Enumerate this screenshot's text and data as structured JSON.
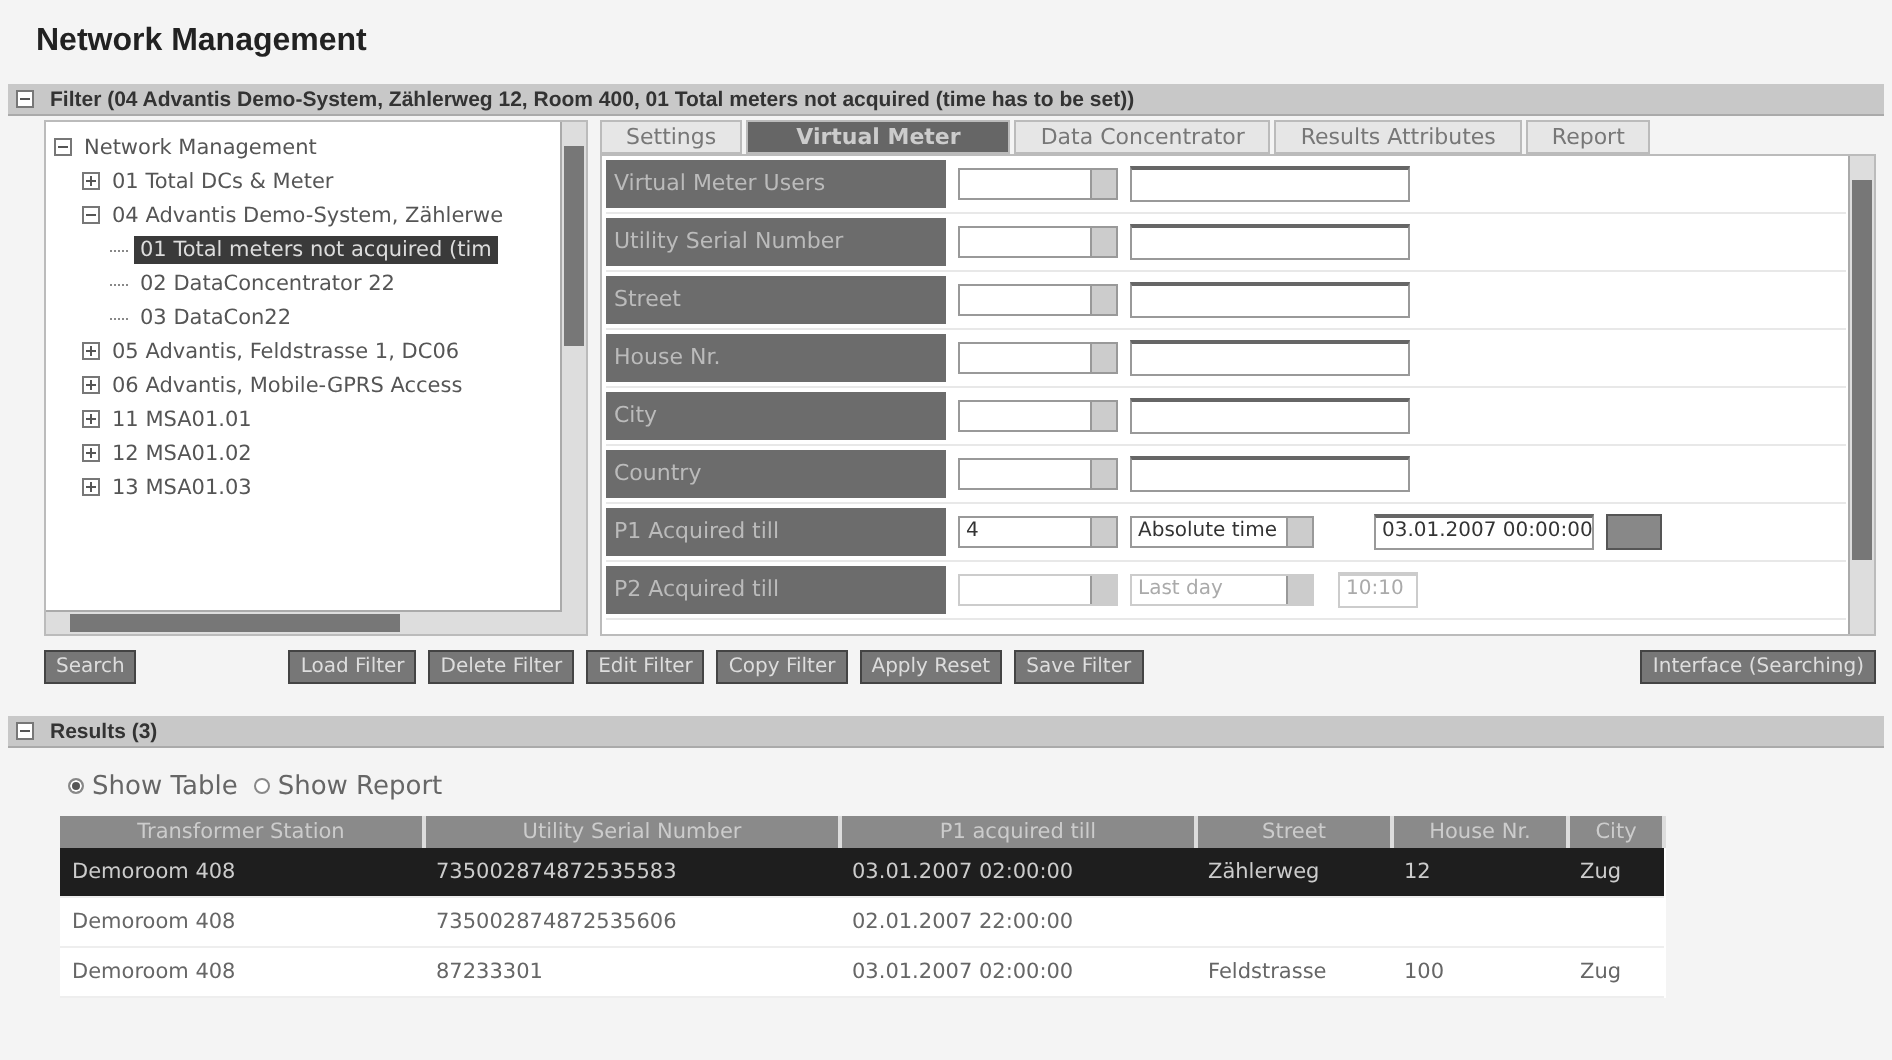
{
  "title": "Network Management",
  "filter": {
    "header": "Filter (04 Advantis Demo-System, Zählerweg 12, Room 400, 01 Total meters not acquired (time has to be set))",
    "expanded": true,
    "tree": [
      {
        "label": "Network Management",
        "expanded": true,
        "selected": false,
        "children": [
          {
            "label": "01 Total DCs & Meter",
            "expanded": false,
            "selected": false
          },
          {
            "label": "04 Advantis Demo-System, Zählerwe",
            "expanded": true,
            "selected": false,
            "children": [
              {
                "label": "01 Total meters not acquired (tim",
                "selected": true
              },
              {
                "label": "02 DataConcentrator 22",
                "selected": false
              },
              {
                "label": "03 DataCon22",
                "selected": false
              }
            ]
          },
          {
            "label": "05 Advantis, Feldstrasse 1, DC06",
            "expanded": false,
            "selected": false
          },
          {
            "label": "06 Advantis, Mobile-GPRS Access",
            "expanded": false,
            "selected": false
          },
          {
            "label": "11 MSA01.01",
            "expanded": false,
            "selected": false
          },
          {
            "label": "12 MSA01.02",
            "expanded": false,
            "selected": false
          },
          {
            "label": "13 MSA01.03",
            "expanded": false,
            "selected": false
          }
        ]
      }
    ],
    "tabs": [
      {
        "label": "Settings",
        "selected": false
      },
      {
        "label": "Virtual Meter",
        "selected": true
      },
      {
        "label": "Data Concentrator",
        "selected": false
      },
      {
        "label": "Results Attributes",
        "selected": false
      },
      {
        "label": "Report",
        "selected": false
      }
    ],
    "rows": [
      {
        "kind": "text",
        "label": "Virtual Meter Users",
        "operator": "",
        "disabled": false
      },
      {
        "kind": "text",
        "label": "Utility Serial Number",
        "operator": "",
        "disabled": false
      },
      {
        "kind": "text",
        "label": "Street",
        "operator": "",
        "disabled": false
      },
      {
        "kind": "text",
        "label": "House Nr.",
        "operator": "",
        "disabled": false
      },
      {
        "kind": "text",
        "label": "City",
        "operator": "",
        "disabled": false
      },
      {
        "kind": "text",
        "label": "Country",
        "operator": "",
        "disabled": false
      },
      {
        "kind": "time",
        "label": "P1 Acquired till",
        "operator": "4",
        "mode": "Absolute time",
        "time": "03.01.2007 00:00:00",
        "disabled": false
      },
      {
        "kind": "time",
        "label": "P2 Acquired till",
        "operator": "",
        "mode": "Last day",
        "time": "10:10",
        "disabled": true
      }
    ],
    "search_buttons": [
      "Search"
    ],
    "filter_buttons": [
      "Load Filter",
      "Delete Filter",
      "Edit Filter",
      "Copy Filter",
      "Apply Reset",
      "Save Filter"
    ],
    "side_buttons": [
      "Interface (Searching)"
    ]
  },
  "results": {
    "header": "Results (3)",
    "expanded": true,
    "views": [
      {
        "label": "Show Table",
        "selected": true
      },
      {
        "label": "Show Report",
        "selected": false
      }
    ],
    "columns": [
      "Transformer Station",
      "Utility Serial Number",
      "P1 acquired till",
      "Street",
      "House Nr.",
      "City"
    ],
    "rows": [
      {
        "selected": true,
        "cells": [
          "Demoroom 408",
          "735002874872535583",
          "03.01.2007 02:00:00",
          "Zählerweg",
          "12",
          "Zug"
        ]
      },
      {
        "selected": false,
        "cells": [
          "Demoroom 408",
          "735002874872535606",
          "02.01.2007 22:00:00",
          "",
          "",
          ""
        ]
      },
      {
        "selected": false,
        "cells": [
          "Demoroom 408",
          "87233301",
          "03.01.2007 02:00:00",
          "Feldstrasse",
          "100",
          "Zug"
        ]
      }
    ]
  }
}
